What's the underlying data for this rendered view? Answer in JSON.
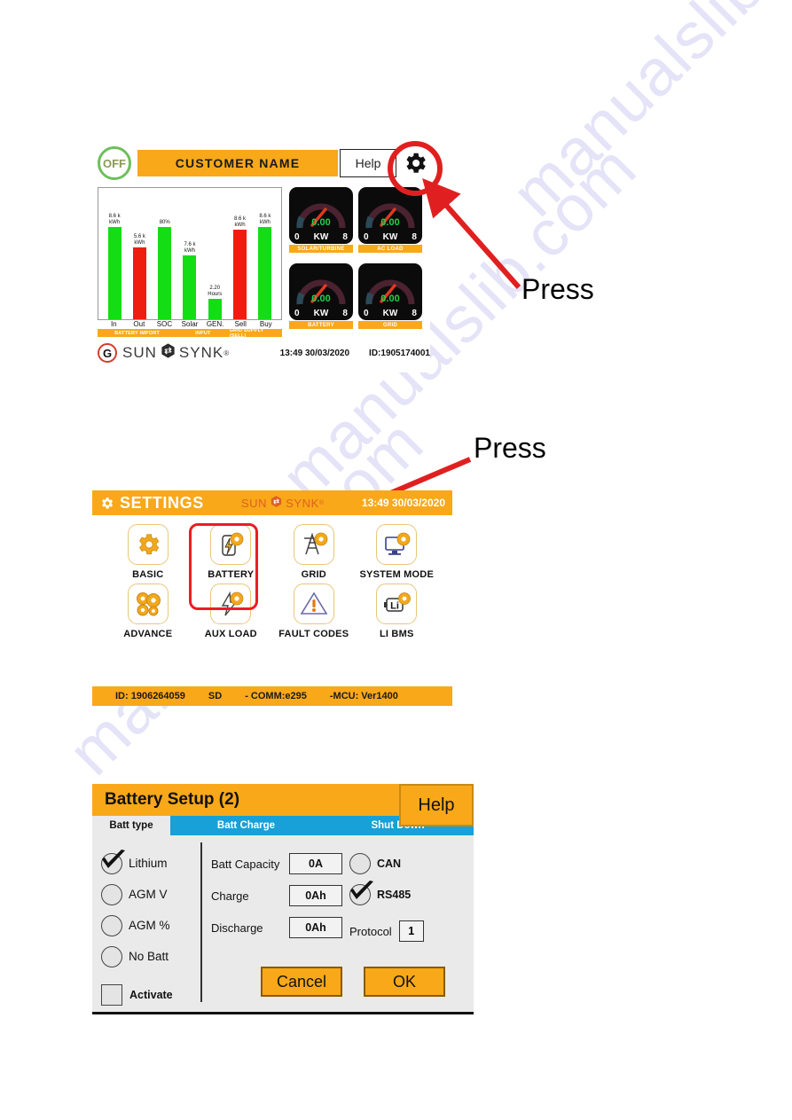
{
  "watermark": {
    "text": "manualslib.com"
  },
  "annotations": {
    "press_top": "Press",
    "press_mid": "Press"
  },
  "home": {
    "status_badge": "OFF",
    "customer_title": "CUSTOMER NAME",
    "help_label": "Help",
    "gear_icon": "gear-icon",
    "footer": {
      "g_mark": "G",
      "brand_left": "SUN",
      "brand_right": "SYNK",
      "brand_sup": "®",
      "time": "13:49 30/03/2020",
      "device_id": "ID:1905174001"
    },
    "gauges": [
      {
        "value": "0.00",
        "unit": "KW",
        "min": "0",
        "max": "8",
        "label": "SOLAR/TURBINE"
      },
      {
        "value": "0.00",
        "unit": "KW",
        "min": "0",
        "max": "8",
        "label": "AC LOAD"
      },
      {
        "value": "0.00",
        "unit": "KW",
        "min": "0",
        "max": "8",
        "label": "BATTERY"
      },
      {
        "value": "0.00",
        "unit": "KW",
        "min": "0",
        "max": "8",
        "label": "GRID"
      }
    ],
    "segments": [
      {
        "label": "BATTERY IMPORT",
        "width": 3
      },
      {
        "label": "INPUT",
        "width": 2
      },
      {
        "label": "GRID SUPPLY (SELL)",
        "width": 2
      }
    ]
  },
  "chart_data": {
    "type": "bar",
    "title": "",
    "xlabel": "",
    "ylabel": "",
    "ylim": [
      0,
      10
    ],
    "grid": false,
    "legend": "none",
    "categories": [
      "In",
      "Out",
      "SOC",
      "Solar",
      "GEN.",
      "Sell",
      "Buy"
    ],
    "values": [
      8.6,
      5.6,
      80,
      7.6,
      2.2,
      8.6,
      8.6
    ],
    "value_labels": [
      "8.6 k\nkWh",
      "5.6 k\nkWh",
      "80%",
      "7.6 k\nkWh",
      "2.20\nHours",
      "8.6 k\nkWh",
      "8.6 k\nkWh"
    ],
    "bar_heights_pct": [
      72,
      56,
      72,
      50,
      16,
      70,
      72
    ],
    "colors": [
      "#15dd15",
      "#ef1d0e",
      "#15dd15",
      "#15dd15",
      "#15dd15",
      "#ef1d0e",
      "#15dd15"
    ]
  },
  "settings": {
    "gear_icon": "gear-icon",
    "title": "SETTINGS",
    "brand_left": "SUN",
    "brand_right": "SYNK",
    "brand_sup": "®",
    "time": "13:49 30/03/2020",
    "items": [
      {
        "label": "BASIC",
        "icon": "gear-icon"
      },
      {
        "label": "BATTERY",
        "icon": "battery-gear-icon"
      },
      {
        "label": "GRID",
        "icon": "pylon-gear-icon"
      },
      {
        "label": "SYSTEM MODE",
        "icon": "monitor-gear-icon"
      },
      {
        "label": "ADVANCE",
        "icon": "multi-gear-icon"
      },
      {
        "label": "AUX LOAD",
        "icon": "bolt-gear-icon"
      },
      {
        "label": "FAULT CODES",
        "icon": "warning-triangle-icon"
      },
      {
        "label": "LI BMS",
        "icon": "lithium-gear-icon"
      }
    ],
    "footer": {
      "id": "ID: 1906264059",
      "sd": "SD",
      "comm": "- COMM:e295",
      "mcu": "-MCU: Ver1400"
    }
  },
  "battery_setup": {
    "title": "Battery Setup (2)",
    "help_label": "Help",
    "tabs": [
      {
        "label": "Batt type",
        "active": true
      },
      {
        "label": "Batt Charge",
        "active": false
      },
      {
        "label": "Shut Down",
        "active": false
      }
    ],
    "batt_types": [
      {
        "label": "Lithium",
        "checked": true
      },
      {
        "label": "AGM V",
        "checked": false
      },
      {
        "label": "AGM %",
        "checked": false
      },
      {
        "label": "No Batt",
        "checked": false
      }
    ],
    "activate": {
      "label": "Activate",
      "checked": false
    },
    "fields": [
      {
        "label": "Batt Capacity",
        "value": "0A"
      },
      {
        "label": "Charge",
        "value": "0Ah"
      },
      {
        "label": "Discharge",
        "value": "0Ah"
      }
    ],
    "comm_options": [
      {
        "label": "CAN",
        "checked": false
      },
      {
        "label": "RS485",
        "checked": true
      }
    ],
    "protocol": {
      "label": "Protocol",
      "value": "1"
    },
    "buttons": {
      "cancel": "Cancel",
      "ok": "OK"
    }
  }
}
